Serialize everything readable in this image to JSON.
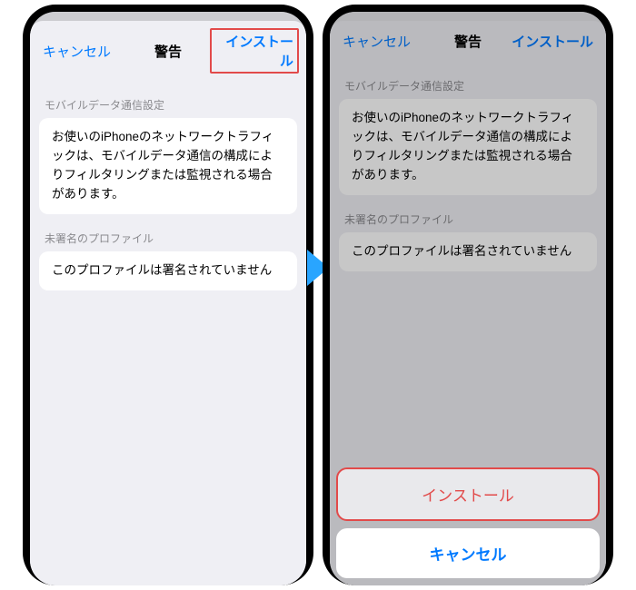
{
  "left": {
    "header": {
      "cancel": "キャンセル",
      "title": "警告",
      "install": "インストール"
    },
    "section1_label": "モバイルデータ通信設定",
    "section1_body": "お使いのiPhoneのネットワークトラフィックは、モバイルデータ通信の構成によりフィルタリングまたは監視される場合があります。",
    "section2_label": "未署名のプロファイル",
    "section2_body": "このプロファイルは署名されていません"
  },
  "right": {
    "header": {
      "cancel": "キャンセル",
      "title": "警告",
      "install": "インストール"
    },
    "section1_label": "モバイルデータ通信設定",
    "section1_body": "お使いのiPhoneのネットワークトラフィックは、モバイルデータ通信の構成によりフィルタリングまたは監視される場合があります。",
    "section2_label": "未署名のプロファイル",
    "section2_body": "このプロファイルは署名されていません",
    "sheet": {
      "install": "インストール",
      "cancel": "キャンセル"
    }
  }
}
